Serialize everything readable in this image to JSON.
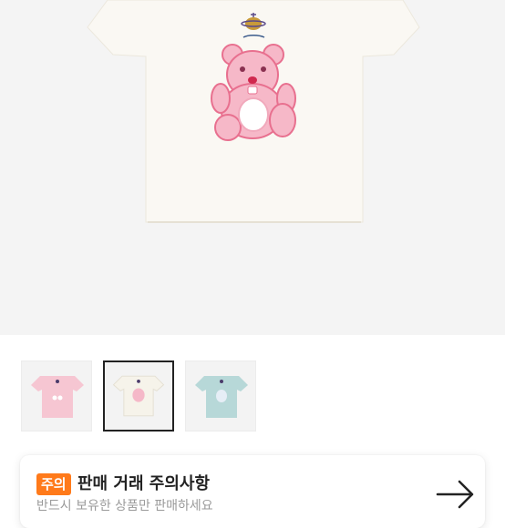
{
  "product": {
    "gallery": {
      "main_image": "cream-tshirt-pink-bear-print",
      "thumbnails": [
        {
          "name": "pink-tshirt",
          "color": "#f6c6d2",
          "selected": false
        },
        {
          "name": "cream-tshirt",
          "color": "#f6f3ea",
          "selected": true
        },
        {
          "name": "mint-tshirt",
          "color": "#b7d8d8",
          "selected": false
        }
      ]
    }
  },
  "notice": {
    "badge": "주의",
    "title": "판매 거래 주의사항",
    "subtitle": "반드시 보유한 상품만 판매하세요",
    "arrow_icon": "arrow-right-icon",
    "accent_color": "#ff7a1a"
  }
}
